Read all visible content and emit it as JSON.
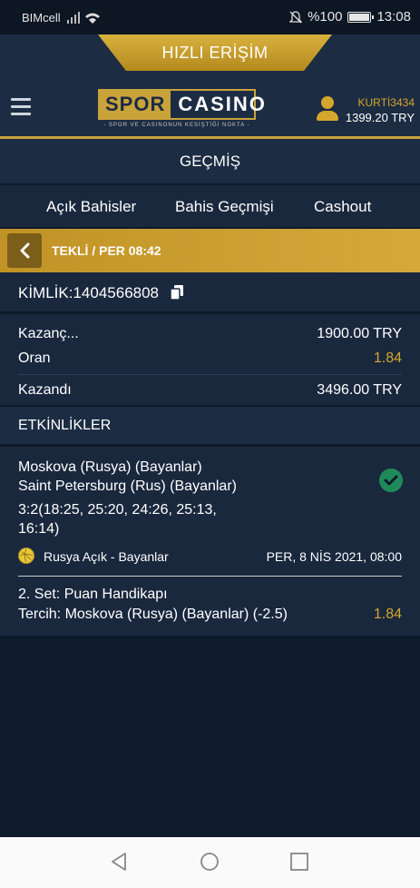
{
  "status_bar": {
    "carrier": "BIMcell",
    "battery": "%100",
    "time": "13:08"
  },
  "header": {
    "quick_access": "HIZLI ERİŞİM",
    "logo": {
      "left": "SPOR",
      "right": "CASINO",
      "tagline": "- SPOR VE CASINONUN KESİŞTİĞİ NOKTA -"
    },
    "user": {
      "name": "KURTİ3434",
      "balance": "1399.20 TRY"
    }
  },
  "page_title": "GEÇMİŞ",
  "tabs": [
    "Açık Bahisler",
    "Bahis Geçmişi",
    "Cashout"
  ],
  "bet": {
    "header": "TEKLİ / PER 08:42",
    "id_text": "KİMLİK:1404566808",
    "summary": [
      {
        "label": "Kazanç...",
        "value": "1900.00 TRY",
        "accent": false
      },
      {
        "label": "Oran",
        "value": "1.84",
        "accent": true
      },
      {
        "label": "Kazandı",
        "value": "3496.00 TRY",
        "accent": false
      }
    ],
    "events_title": "ETKİNLİKLER",
    "event": {
      "home": "Moskova (Rusya) (Bayanlar)",
      "away": "Saint Petersburg (Rus) (Bayanlar)",
      "score_line1": "3:2(18:25, 25:20, 24:26, 25:13,",
      "score_line2": "16:14)",
      "league": "Rusya Açık - Bayanlar",
      "date": "PER, 8 NİS 2021, 08:00",
      "market": "2. Set: Puan Handikapı",
      "selection": "Tercih: Moskova (Rusya) (Bayanlar) (-2.5)",
      "odds": "1.84"
    }
  },
  "colors": {
    "gold": "#c9a33a",
    "navy": "#1c2c43",
    "success": "#1e8a5a"
  }
}
